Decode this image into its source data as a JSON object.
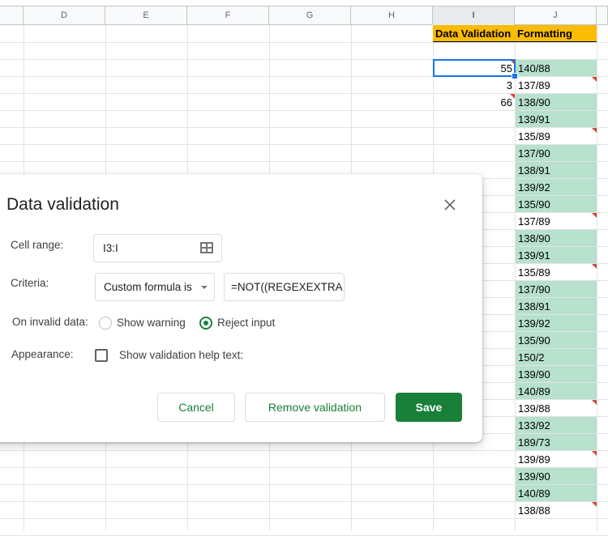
{
  "sheet": {
    "columns": [
      {
        "label": "",
        "selected": false
      },
      {
        "label": "D",
        "selected": false
      },
      {
        "label": "E",
        "selected": false
      },
      {
        "label": "F",
        "selected": false
      },
      {
        "label": "G",
        "selected": false
      },
      {
        "label": "H",
        "selected": false
      },
      {
        "label": "I",
        "selected": true
      },
      {
        "label": "J",
        "selected": false
      },
      {
        "label": "",
        "selected": false
      }
    ],
    "header_row": {
      "i": "Data Validation",
      "j": "Formatting",
      "fill": "#fbbc04"
    },
    "colors": {
      "valid_fill": "#b7e1cd",
      "invalid_flag": "#db4437",
      "selection": "#1a73e8"
    },
    "selected_cell": "I3",
    "rows": [
      {
        "i": "",
        "j": "",
        "j_status": "empty"
      },
      {
        "i": "55",
        "i_flag": true,
        "j": "140/88",
        "j_status": "valid"
      },
      {
        "i": "3",
        "i_flag": false,
        "j": "137/89",
        "j_status": "invalid"
      },
      {
        "i": "66",
        "i_flag": true,
        "j": "138/90",
        "j_status": "valid"
      },
      {
        "i": "",
        "j": "139/91",
        "j_status": "valid"
      },
      {
        "i": "",
        "j": "135/89",
        "j_status": "invalid"
      },
      {
        "i": "",
        "j": "137/90",
        "j_status": "valid"
      },
      {
        "i": "",
        "j": "138/91",
        "j_status": "valid"
      },
      {
        "i": "",
        "j": "139/92",
        "j_status": "valid"
      },
      {
        "i": "",
        "j": "135/90",
        "j_status": "valid"
      },
      {
        "i": "",
        "j": "137/89",
        "j_status": "invalid"
      },
      {
        "i": "",
        "j": "138/90",
        "j_status": "valid"
      },
      {
        "i": "",
        "j": "139/91",
        "j_status": "valid"
      },
      {
        "i": "",
        "j": "135/89",
        "j_status": "invalid"
      },
      {
        "i": "",
        "j": "137/90",
        "j_status": "valid"
      },
      {
        "i": "",
        "j": "138/91",
        "j_status": "valid"
      },
      {
        "i": "",
        "j": "139/92",
        "j_status": "valid"
      },
      {
        "i": "",
        "j": "135/90",
        "j_status": "valid"
      },
      {
        "i": "",
        "j": "150/2",
        "j_status": "valid"
      },
      {
        "i": "",
        "j": "139/90",
        "j_status": "valid"
      },
      {
        "i": "",
        "j": "140/89",
        "j_status": "valid"
      },
      {
        "i": "",
        "j": "139/88",
        "j_status": "invalid"
      },
      {
        "i": "",
        "j": "133/92",
        "j_status": "valid"
      },
      {
        "i": "",
        "j": "189/73",
        "j_status": "valid"
      },
      {
        "i": "",
        "j": "139/89",
        "j_status": "invalid"
      },
      {
        "i": "",
        "j": "139/90",
        "j_status": "valid"
      },
      {
        "i": "",
        "j": "140/89",
        "j_status": "valid"
      },
      {
        "i": "",
        "j": "138/88",
        "j_status": "invalid"
      },
      {
        "i": "",
        "j": "",
        "j_status": "empty"
      }
    ]
  },
  "dialog": {
    "title": "Data validation",
    "close_icon": "close-icon",
    "cell_range_label": "Cell range:",
    "cell_range_value": "I3:I",
    "range_icon": "grid-select-icon",
    "criteria_label": "Criteria:",
    "criteria_selected": "Custom formula is",
    "criteria_formula": "=NOT((REGEXEXTRA",
    "invalid_label": "On invalid data:",
    "invalid_options": [
      {
        "label": "Show warning",
        "checked": false
      },
      {
        "label": "Reject input",
        "checked": true
      }
    ],
    "appearance_label": "Appearance:",
    "help_text_label": "Show validation help text:",
    "help_text_checked": false,
    "buttons": {
      "cancel": "Cancel",
      "remove": "Remove validation",
      "save": "Save"
    },
    "accent": "#188038"
  }
}
